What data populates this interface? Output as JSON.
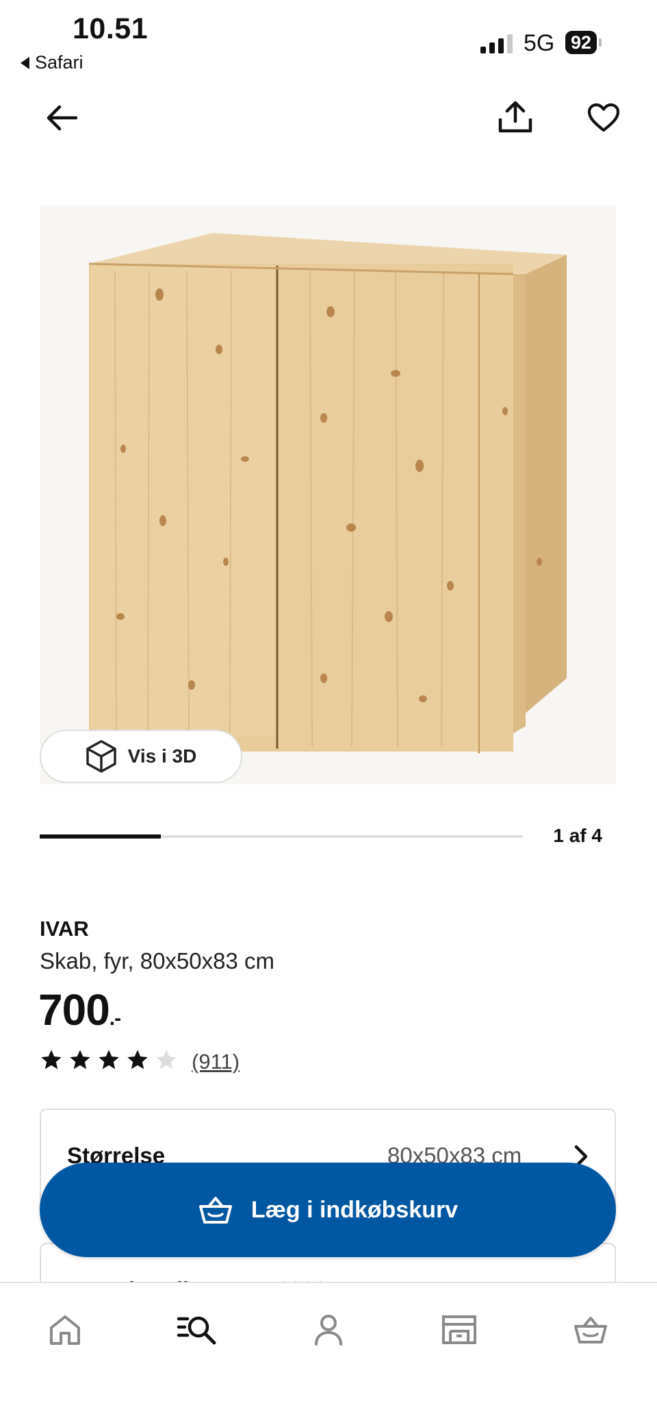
{
  "status_bar": {
    "time": "10.51",
    "back_app": "Safari",
    "network": "5G",
    "battery": "92"
  },
  "nav": {
    "back_icon": "arrow-left-icon",
    "share_icon": "share-icon",
    "favorite_icon": "heart-icon"
  },
  "gallery": {
    "view_3d_label": "Vis i 3D",
    "position_label": "1 af 4",
    "progress_fraction": 0.25
  },
  "product": {
    "name": "IVAR",
    "description": "Skab, fyr, 80x50x83 cm",
    "price": "700",
    "price_suffix": ".-",
    "rating": 4,
    "rating_max": 5,
    "review_count": "(911)"
  },
  "options": {
    "size_label": "Størrelse",
    "size_value": "80x50x83 cm",
    "next_card_text": "Levering til postnr. 2300"
  },
  "actions": {
    "add_to_cart": "Læg i indkøbskurv"
  },
  "tabbar": {
    "items": [
      "home-icon",
      "search-icon",
      "profile-icon",
      "store-icon",
      "cart-icon"
    ],
    "active": "search-icon"
  },
  "colors": {
    "primary_blue": "#0058a3",
    "wood_light": "#e9cfa3",
    "wood_mid": "#d9b785",
    "inactive_icon": "#8a8a8a"
  }
}
